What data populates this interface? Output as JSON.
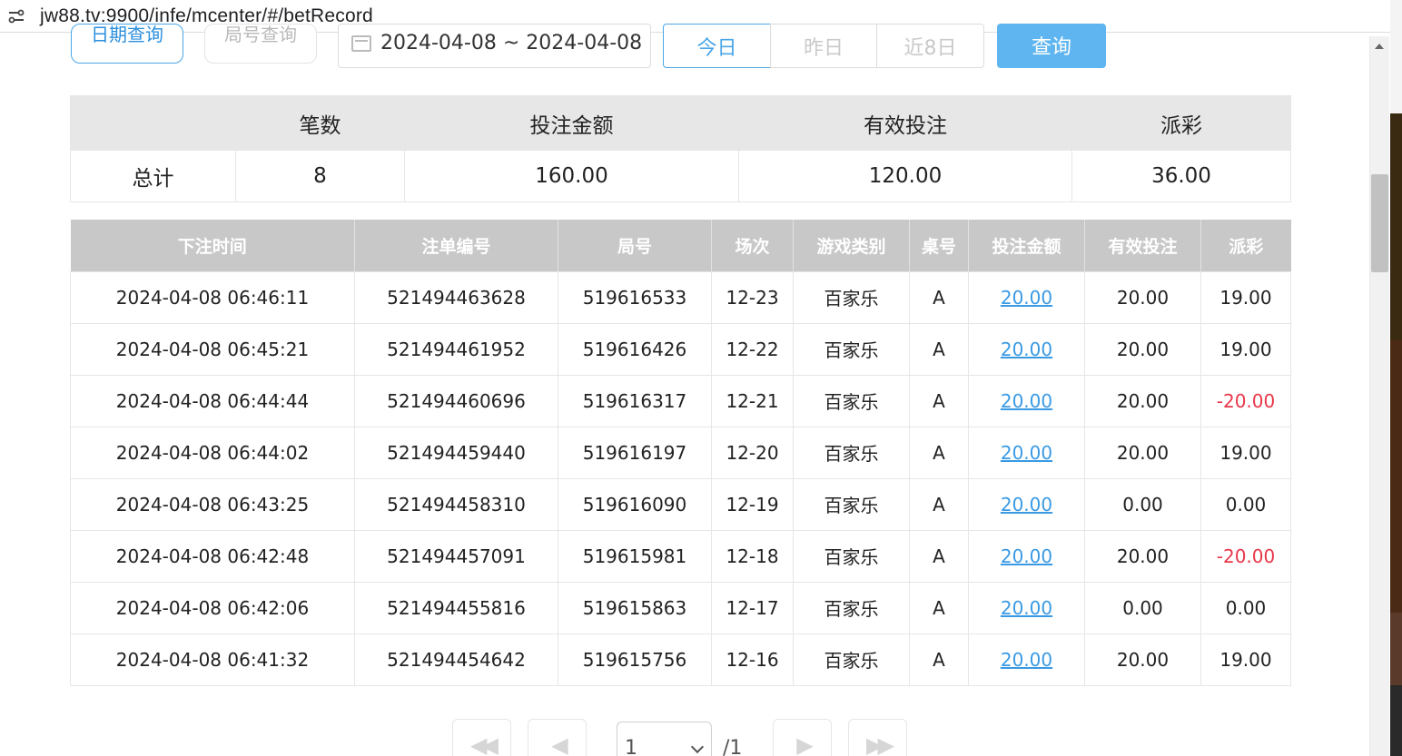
{
  "browser": {
    "url": "jw88.tv:9900/infe/mcenter/#/betRecord"
  },
  "filters": {
    "date_query_label": "日期查询",
    "round_query_label": "局号查询",
    "date_range": "2024-04-08 ~ 2024-04-08",
    "today_label": "今日",
    "yesterday_label": "昨日",
    "last8_label": "近8日",
    "query_label": "查询"
  },
  "summary": {
    "headers": [
      "",
      "笔数",
      "投注金额",
      "有效投注",
      "派彩"
    ],
    "row": {
      "label": "总计",
      "count": "8",
      "bet_amount": "160.00",
      "valid_bet": "120.00",
      "payout": "36.00"
    }
  },
  "records": {
    "headers": [
      "下注时间",
      "注单编号",
      "局号",
      "场次",
      "游戏类别",
      "桌号",
      "投注金额",
      "有效投注",
      "派彩"
    ],
    "rows": [
      {
        "time": "2024-04-08 06:46:11",
        "order": "521494463628",
        "round": "519616533",
        "session": "12-23",
        "game": "百家乐",
        "table": "A",
        "amount": "20.00",
        "valid": "20.00",
        "payout": "19.00",
        "negative": false
      },
      {
        "time": "2024-04-08 06:45:21",
        "order": "521494461952",
        "round": "519616426",
        "session": "12-22",
        "game": "百家乐",
        "table": "A",
        "amount": "20.00",
        "valid": "20.00",
        "payout": "19.00",
        "negative": false
      },
      {
        "time": "2024-04-08 06:44:44",
        "order": "521494460696",
        "round": "519616317",
        "session": "12-21",
        "game": "百家乐",
        "table": "A",
        "amount": "20.00",
        "valid": "20.00",
        "payout": "-20.00",
        "negative": true
      },
      {
        "time": "2024-04-08 06:44:02",
        "order": "521494459440",
        "round": "519616197",
        "session": "12-20",
        "game": "百家乐",
        "table": "A",
        "amount": "20.00",
        "valid": "20.00",
        "payout": "19.00",
        "negative": false
      },
      {
        "time": "2024-04-08 06:43:25",
        "order": "521494458310",
        "round": "519616090",
        "session": "12-19",
        "game": "百家乐",
        "table": "A",
        "amount": "20.00",
        "valid": "0.00",
        "payout": "0.00",
        "negative": false
      },
      {
        "time": "2024-04-08 06:42:48",
        "order": "521494457091",
        "round": "519615981",
        "session": "12-18",
        "game": "百家乐",
        "table": "A",
        "amount": "20.00",
        "valid": "20.00",
        "payout": "-20.00",
        "negative": true
      },
      {
        "time": "2024-04-08 06:42:06",
        "order": "521494455816",
        "round": "519615863",
        "session": "12-17",
        "game": "百家乐",
        "table": "A",
        "amount": "20.00",
        "valid": "0.00",
        "payout": "0.00",
        "negative": false
      },
      {
        "time": "2024-04-08 06:41:32",
        "order": "521494454642",
        "round": "519615756",
        "session": "12-16",
        "game": "百家乐",
        "table": "A",
        "amount": "20.00",
        "valid": "20.00",
        "payout": "19.00",
        "negative": false
      }
    ]
  },
  "pagination": {
    "current_page": "1",
    "total_pages": "/1",
    "icons": [
      "first-page-icon",
      "prev-page-icon",
      "next-page-icon",
      "last-page-icon"
    ]
  },
  "colors": {
    "accent": "#4aa6e7",
    "query_button": "#5fb5ef",
    "header_gray": "#c8c8c8",
    "negative": "#e8374a",
    "link": "#3a9ae4"
  }
}
